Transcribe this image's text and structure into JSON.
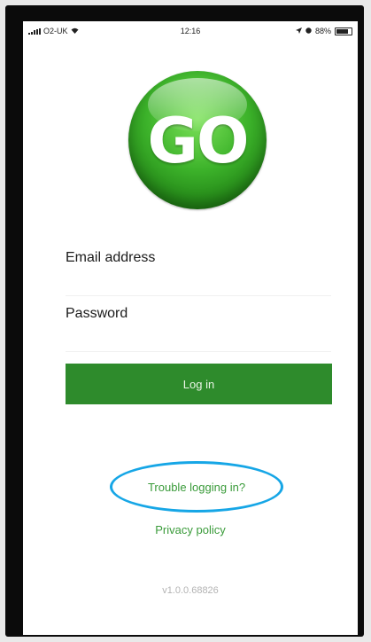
{
  "status_bar": {
    "carrier": "O2-UK",
    "time": "12:16",
    "battery": "88%"
  },
  "logo": {
    "text": "GO"
  },
  "form": {
    "email_label": "Email address",
    "email_value": "",
    "password_label": "Password",
    "password_value": "",
    "login_label": "Log in"
  },
  "links": {
    "trouble": "Trouble logging in?",
    "privacy": "Privacy policy"
  },
  "version": "v1.0.0.68826",
  "colors": {
    "brand_green": "#2e8b2c",
    "link_green": "#3a9b3a",
    "highlight_ring": "#16a6e6"
  }
}
